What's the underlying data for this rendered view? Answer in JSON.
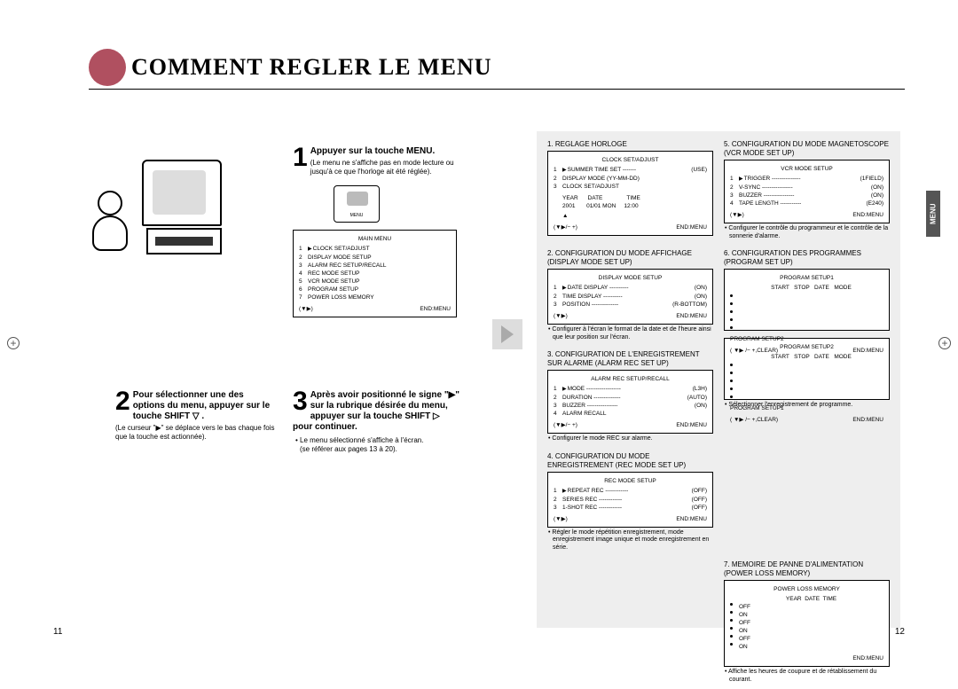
{
  "header": {
    "title": "COMMENT REGLER LE MENU"
  },
  "sideTab": "MENU",
  "pageLeft": "11",
  "pageRight": "12",
  "step1": {
    "num": "1",
    "bold": "Appuyer sur la touche MENU.",
    "sub": "(Le menu ne s'affiche pas en mode lecture ou jusqu'à ce que l'horloge ait été réglée).",
    "remoteLabel": "MENU",
    "mainMenuTitle": "MAIN MENU",
    "mainMenu": [
      "CLOCK SET/ADJUST",
      "DISPLAY MODE SETUP",
      "ALARM REC SETUP/RECALL",
      "REC MODE SETUP",
      "VCR MODE SETUP",
      "PROGRAM SETUP",
      "POWER LOSS MEMORY"
    ],
    "footLeft": "(▼▶)",
    "footRight": "END:MENU"
  },
  "step2": {
    "num": "2",
    "bold": "Pour sélectionner une des options du menu, appuyer sur le touche SHIFT ▽ .",
    "sub": "(Le curseur \"▶\" se déplace vers le bas chaque fois que la touche est actionnée)."
  },
  "step3": {
    "num": "3",
    "bold": "Après avoir positionné le signe \"▶\" sur la rubrique désirée du menu, appuyer sur la touche SHIFT ▷ pour continuer.",
    "b1": "• Le menu sélectionné s'affiche à l'écran.",
    "b2": "(se référer aux pages 13 à 20)."
  },
  "sec1": {
    "title": "1. REGLAGE HORLOGE",
    "osdTitle": "CLOCK SET/ADJUST",
    "rows": [
      {
        "n": "1",
        "lbl": "SUMMER TIME SET",
        "val": "(USE)",
        "sel": true
      },
      {
        "n": "2",
        "lbl": "DISPLAY MODE (YY-MM-DD)",
        "val": ""
      },
      {
        "n": "3",
        "lbl": "CLOCK SET/ADJUST",
        "val": ""
      }
    ],
    "dateHdr": "YEAR      DATE               TIME",
    "dateRow": "2001       01/01 MON     12:00",
    "footLeft": "(▼▶/− +)",
    "footRight": "END:MENU"
  },
  "sec2": {
    "title": "2. CONFIGURATION DU MODE AFFICHAGE (DISPLAY MODE SET UP)",
    "osdTitle": "DISPLAY MODE SETUP",
    "rows": [
      {
        "n": "1",
        "lbl": "DATE DISPLAY",
        "val": "(ON)",
        "sel": true
      },
      {
        "n": "2",
        "lbl": "TIME DISPLAY",
        "val": "(ON)"
      },
      {
        "n": "3",
        "lbl": "POSITION",
        "val": "(R-BOTTOM)"
      }
    ],
    "footLeft": "(▼▶)",
    "footRight": "END:MENU",
    "note": "• Configurer à l'écran le format de la date et de l'heure ainsi que leur position sur l'écran."
  },
  "sec3": {
    "title": "3. CONFIGURATION DE L'ENREGISTREMENT SUR ALARME (ALARM REC SET UP)",
    "osdTitle": "ALARM REC SETUP/RECALL",
    "rows": [
      {
        "n": "1",
        "lbl": "MODE",
        "val": "(L3H)",
        "sel": true
      },
      {
        "n": "2",
        "lbl": "DURATION",
        "val": "(AUTO)"
      },
      {
        "n": "3",
        "lbl": "BUZZER",
        "val": "(ON)"
      },
      {
        "n": "4",
        "lbl": "ALARM RECALL",
        "val": ""
      }
    ],
    "footLeft": "(▼▶/− +)",
    "footRight": "END:MENU",
    "note": "• Configurer le mode REC sur alarme."
  },
  "sec4": {
    "title": "4. CONFIGURATION DU MODE ENREGISTREMENT (REC MODE SET UP)",
    "osdTitle": "REC MODE SETUP",
    "rows": [
      {
        "n": "1",
        "lbl": "REPEAT REC",
        "val": "(OFF)",
        "sel": true
      },
      {
        "n": "2",
        "lbl": "SERIES REC",
        "val": "(OFF)"
      },
      {
        "n": "3",
        "lbl": "1-SHOT REC",
        "val": "(OFF)"
      }
    ],
    "footLeft": "(▼▶)",
    "footRight": "END:MENU",
    "note": "• Régler le mode répétition enregistrement, mode enregistrement image unique et mode enregistrement en série."
  },
  "sec5": {
    "title": "5. CONFIGURATION DU MODE MAGNETOSCOPE (VCR MODE SET UP)",
    "osdTitle": "VCR MODE SETUP",
    "rows": [
      {
        "n": "1",
        "lbl": "TRIGGER",
        "val": "(1FIELD)",
        "sel": true
      },
      {
        "n": "2",
        "lbl": "V-SYNC",
        "val": "(ON)"
      },
      {
        "n": "3",
        "lbl": "BUZZER",
        "val": "(ON)"
      },
      {
        "n": "4",
        "lbl": "TAPE LENGTH",
        "val": "(E240)"
      }
    ],
    "footLeft": "(▼▶)",
    "footRight": "END:MENU",
    "note": "• Configurer le contrôle du programmeur et le contrôle de la sonnerie d'alarme."
  },
  "sec6": {
    "title": "6. CONFIGURATION DES PROGRAMMES (PROGRAM SET UP)",
    "box1Title": "PROGRAM SETUP1",
    "boxHdr": "START   STOP   DATE   MODE",
    "box1bottom": "PROGRAM SETUP2",
    "box2Title": "PROGRAM SETUP2",
    "box2bottom": "PROGRAM SETUP1",
    "footLeft": "( ▼▶ /− +,CLEAR)",
    "footRight": "END:MENU",
    "note": "• Sélectionner l'enregistrement de programme."
  },
  "sec7": {
    "title": "7. MEMOIRE DE PANNE D'ALIMENTATION (POWER LOSS MEMORY)",
    "osdTitle": "POWER LOSS MEMORY",
    "hdr": "YEAR  DATE  TIME",
    "states": [
      "OFF",
      "ON",
      "OFF",
      "ON",
      "OFF",
      "ON"
    ],
    "footRight": "END:MENU",
    "note": "• Affiche les heures de coupure et de rétablissement du courant."
  }
}
